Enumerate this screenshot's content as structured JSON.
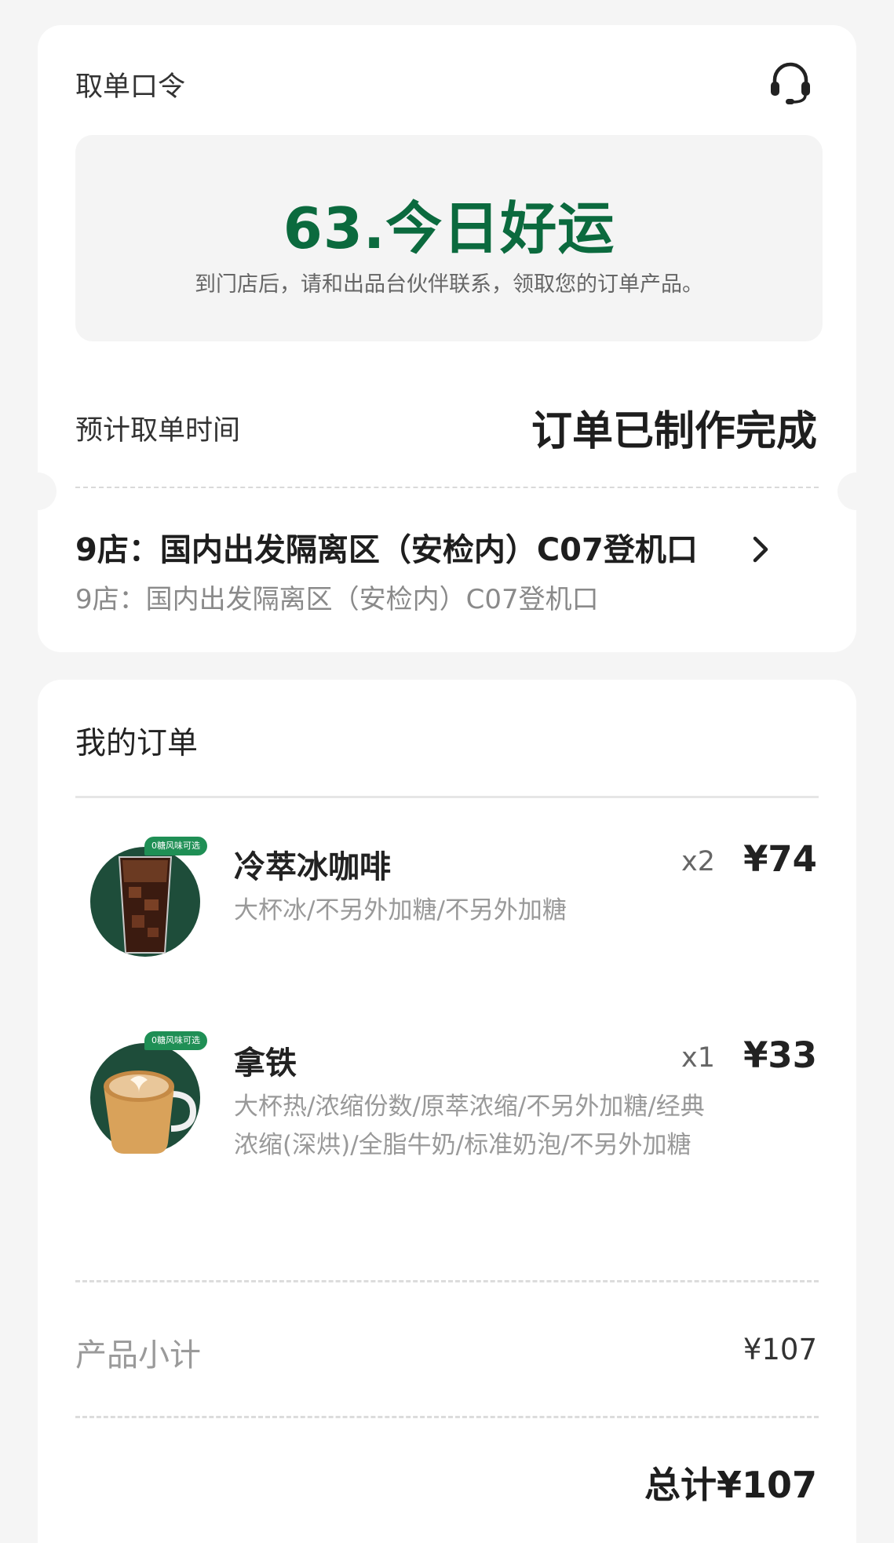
{
  "pickup": {
    "code_label": "取单口令",
    "code": "63.今日好运",
    "code_hint": "到门店后，请和出品台伙伴联系，领取您的订单产品。",
    "eta_label": "预计取单时间",
    "status": "订单已制作完成",
    "store_name": "9店：国内出发隔离区（安检内）C07登机口",
    "store_address": "9店：国内出发隔离区（安检内）C07登机口",
    "icons": {
      "support": "headset-icon",
      "store": "chevron-right-icon"
    }
  },
  "order": {
    "title": "我的订单",
    "items": [
      {
        "tag": "0糖风味可选",
        "name": "冷萃冰咖啡",
        "qty": "x2",
        "price": "¥74",
        "desc": "大杯冰/不另外加糖/不另外加糖"
      },
      {
        "tag": "0糖风味可选",
        "name": "拿铁",
        "qty": "x1",
        "price": "¥33",
        "desc": "大杯热/浓缩份数/原萃浓缩/不另外加糖/经典浓缩(深烘)/全脂牛奶/标准奶泡/不另外加糖"
      }
    ],
    "subtotal_label": "产品小计",
    "subtotal_value": "¥107",
    "total": "总计¥107"
  },
  "colors": {
    "brand_green": "#0b6a3e",
    "thumb_bg": "#1e4d3a",
    "tag_green": "#1f8f55"
  }
}
